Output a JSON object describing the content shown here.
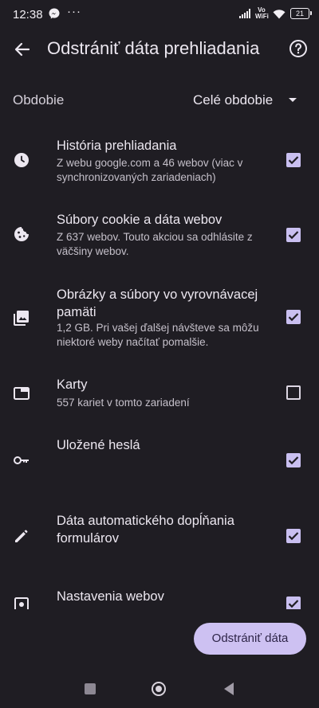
{
  "status_bar": {
    "time": "12:38",
    "dots": "···",
    "vowifi": "Vo WiFi",
    "battery": "21"
  },
  "header": {
    "title": "Odstrániť dáta prehliadania"
  },
  "period": {
    "label": "Obdobie",
    "value": "Celé obdobie"
  },
  "items": [
    {
      "title": "História prehliadania",
      "subtitle": "Z webu google.com a 46 webov (viac v synchronizovaných zariadeniach)",
      "checked": true,
      "icon": "clock-icon"
    },
    {
      "title": "Súbory cookie a dáta webov",
      "subtitle": "Z 637 webov. Touto akciou sa odhlásite z väčšiny webov.",
      "checked": true,
      "icon": "cookie-icon"
    },
    {
      "title": "Obrázky a súbory vo vyrovnávacej pamäti",
      "subtitle": "1,2 GB. Pri vašej ďalšej návšteve sa môžu niektoré weby načítať pomalšie.",
      "checked": true,
      "icon": "images-icon"
    },
    {
      "title": "Karty",
      "subtitle": "557 kariet v tomto zariadení",
      "checked": false,
      "icon": "tab-icon"
    },
    {
      "title": "Uložené heslá",
      "subtitle": "",
      "checked": true,
      "icon": "key-icon"
    },
    {
      "title": "Dáta automatického dopĺňania formulárov",
      "subtitle": "",
      "checked": true,
      "icon": "pencil-icon"
    },
    {
      "title": "Nastavenia webov",
      "subtitle": "",
      "checked": true,
      "icon": "site-settings-icon"
    }
  ],
  "actions": {
    "delete_label": "Odstrániť dáta"
  },
  "colors": {
    "background": "#1f1d23",
    "accent": "#cdc1f2",
    "checkbox": "#c9bff0"
  }
}
